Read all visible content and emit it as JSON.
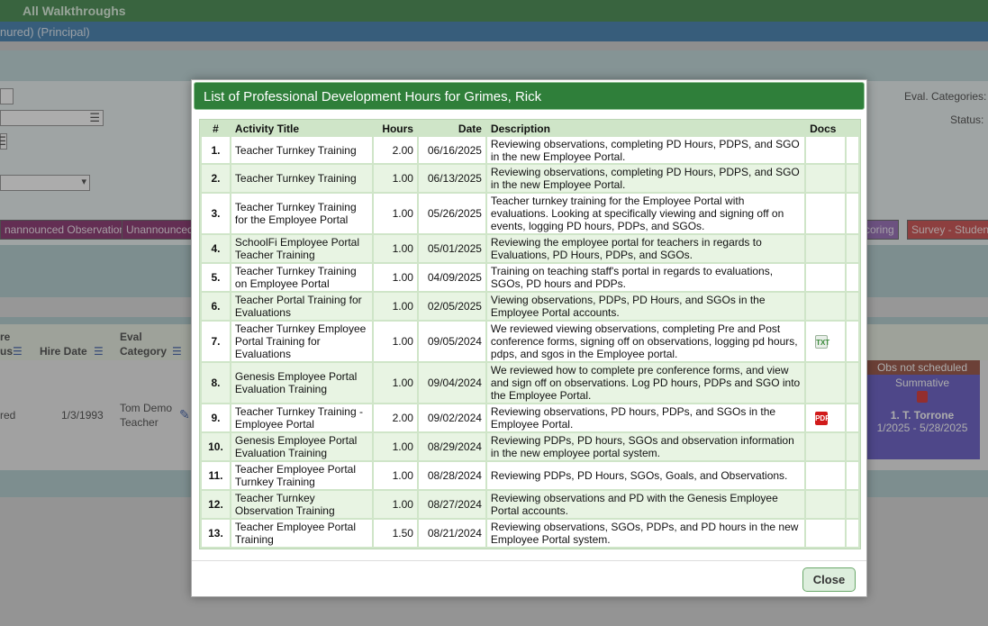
{
  "background": {
    "nav_title": "All Walkthroughs",
    "user_line": "nured)  (Principal)",
    "labels": {
      "eval_categories": "Eval. Categories:",
      "status": "Status:"
    },
    "tags": [
      {
        "label": "nannounced Observation",
        "bg": "#7a1a5e",
        "color": "#f3e3ef"
      },
      {
        "label": "Unannounced",
        "bg": "#7a1a5e",
        "color": "#f3e3ef"
      },
      {
        "label": "coring",
        "bg": "#8a5ab0",
        "color": "#f1e8f8"
      },
      {
        "label": "Survey - Studen",
        "bg": "#c63a3a",
        "color": "#fde8e8"
      }
    ],
    "table_headers": {
      "col1a": "re",
      "col1b": "us",
      "hire_date": "Hire Date",
      "eval_category_1": "Eval",
      "eval_category_2": "Category"
    },
    "row": {
      "status": "red",
      "hire_date": "1/3/1993",
      "category_1": "Tom Demo",
      "category_2": "Teacher"
    },
    "obs_card": {
      "head": "Obs not scheduled",
      "type": "Summative",
      "evaluator": "1. T. Torrone",
      "dates": "1/2025 - 5/28/2025"
    }
  },
  "modal": {
    "title": "List of Professional Development Hours for Grimes, Rick",
    "columns": {
      "num": "#",
      "title": "Activity Title",
      "hours": "Hours",
      "date": "Date",
      "description": "Description",
      "docs": "Docs"
    },
    "rows": [
      {
        "num": "1.",
        "title": "Teacher Turnkey Training",
        "hours": "2.00",
        "date": "06/16/2025",
        "description": "Reviewing observations, completing PD Hours, PDPS, and SGO in the new Employee Portal.",
        "doc": ""
      },
      {
        "num": "2.",
        "title": "Teacher Turnkey Training",
        "hours": "1.00",
        "date": "06/13/2025",
        "description": "Reviewing observations, completing PD Hours, PDPS, and SGO in the new Employee Portal.",
        "doc": ""
      },
      {
        "num": "3.",
        "title": "Teacher Turnkey Training for the Employee Portal",
        "hours": "1.00",
        "date": "05/26/2025",
        "description": "Teacher turnkey training for the Employee Portal with evaluations. Looking at specifically viewing and signing off on events, logging PD hours, PDPs, and SGOs.",
        "doc": ""
      },
      {
        "num": "4.",
        "title": "SchoolFi Employee Portal Teacher Training",
        "hours": "1.00",
        "date": "05/01/2025",
        "description": "Reviewing the employee portal for teachers in regards to Evaluations, PD Hours, PDPs, and SGOs.",
        "doc": ""
      },
      {
        "num": "5.",
        "title": "Teacher Turnkey Training on Employee Portal",
        "hours": "1.00",
        "date": "04/09/2025",
        "description": "Training on teaching staff's portal in regards to evaluations, SGOs, PD hours and PDPs.",
        "doc": ""
      },
      {
        "num": "6.",
        "title": "Teacher Portal Training for Evaluations",
        "hours": "1.00",
        "date": "02/05/2025",
        "description": "Viewing observations, PDPs, PD Hours, and SGOs in the Employee Portal accounts.",
        "doc": ""
      },
      {
        "num": "7.",
        "title": "Teacher Turnkey Employee Portal Training for Evaluations",
        "hours": "1.00",
        "date": "09/05/2024",
        "description": "We reviewed viewing observations, completing Pre and Post conference forms, signing off on observations, logging pd hours, pdps, and sgos in the Employee portal.",
        "doc": "txt"
      },
      {
        "num": "8.",
        "title": "Genesis Employee Portal Evaluation Training",
        "hours": "1.00",
        "date": "09/04/2024",
        "description": "We reviewed how to complete pre conference forms, and view and sign off on observations. Log PD hours, PDPs and SGO into the Employee Portal.",
        "doc": ""
      },
      {
        "num": "9.",
        "title": "Teacher Turnkey Training - Employee Portal",
        "hours": "2.00",
        "date": "09/02/2024",
        "description": "Reviewing observations, PD hours, PDPs, and SGOs in the Employee Portal.",
        "doc": "pdf"
      },
      {
        "num": "10.",
        "title": "Genesis Employee Portal Evaluation Training",
        "hours": "1.00",
        "date": "08/29/2024",
        "description": "Reviewing PDPs, PD hours, SGOs and observation information in the new employee portal system.",
        "doc": ""
      },
      {
        "num": "11.",
        "title": "Teacher Employee Portal Turnkey Training",
        "hours": "1.00",
        "date": "08/28/2024",
        "description": "Reviewing PDPs, PD Hours, SGOs, Goals, and Observations.",
        "doc": ""
      },
      {
        "num": "12.",
        "title": "Teacher Turnkey Observation Training",
        "hours": "1.00",
        "date": "08/27/2024",
        "description": "Reviewing observations and PD with the Genesis Employee Portal accounts.",
        "doc": ""
      },
      {
        "num": "13.",
        "title": "Teacher Employee Portal Training",
        "hours": "1.50",
        "date": "08/21/2024",
        "description": "Reviewing observations, SGOs, PDPs, and PD hours in the new Employee Portal system.",
        "doc": ""
      }
    ],
    "doc_icons": {
      "txt": "TXT",
      "pdf": "PDF"
    },
    "close_label": "Close"
  }
}
